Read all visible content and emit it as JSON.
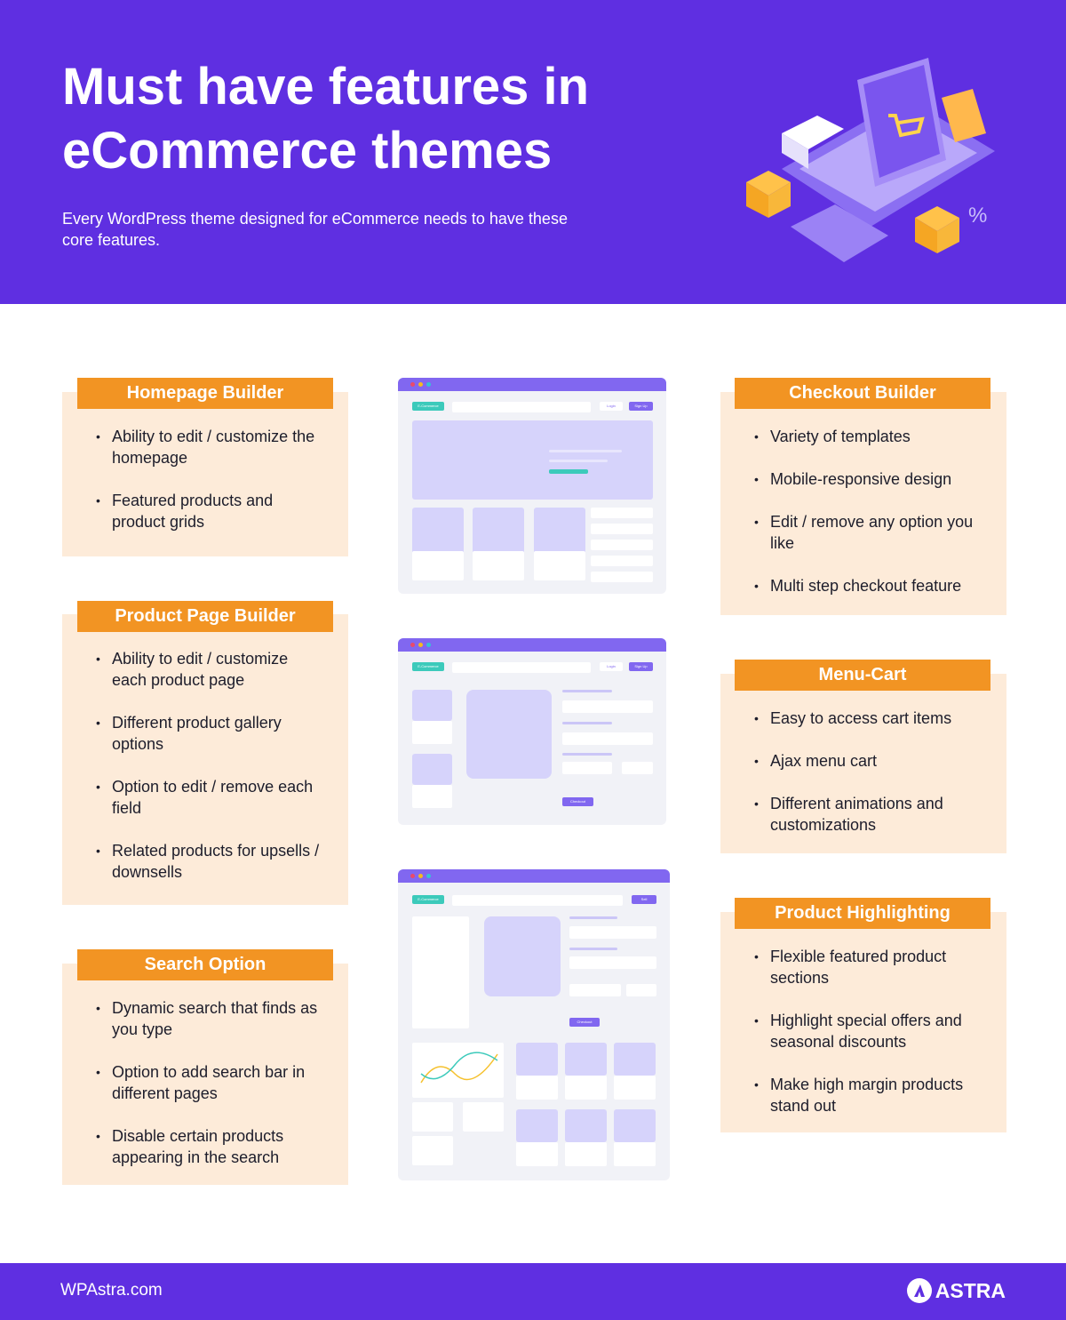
{
  "header": {
    "title": "Must have features in eCommerce themes",
    "subtitle": "Every WordPress theme designed for eCommerce needs to have these core features.",
    "illustration": "laptop-shopping-cart-illustration"
  },
  "colors": {
    "primary": "#5f2fe1",
    "accent": "#f29423",
    "card": "#fdebd9",
    "teal": "#3ccabb"
  },
  "features": [
    {
      "title": "Homepage Builder",
      "items": [
        "Ability to edit / customize the homepage",
        "Featured products and product grids"
      ]
    },
    {
      "title": "Product Page Builder",
      "items": [
        "Ability to edit / customize each product page",
        "Different product gallery options",
        "Option to edit / remove each field",
        "Related products for upsells / downsells"
      ]
    },
    {
      "title": "Search Option",
      "items": [
        "Dynamic search that finds as you type",
        "Option to add search bar in different pages",
        "Disable certain products appearing in the search"
      ]
    },
    {
      "title": "Checkout Builder",
      "items": [
        "Variety of templates",
        "Mobile-responsive design",
        "Edit / remove any option you like",
        "Multi step checkout feature"
      ]
    },
    {
      "title": "Menu-Cart",
      "items": [
        "Easy to access cart items",
        "Ajax menu cart",
        "Different animations and customizations"
      ]
    },
    {
      "title": "Product Highlighting",
      "items": [
        "Flexible featured product sections",
        "Highlight special offers and seasonal discounts",
        "Make high margin products stand out"
      ]
    }
  ],
  "mockups": {
    "brand": "E-Commerce",
    "login": "Login",
    "signup": "Sign Up",
    "checkout": "Checkout",
    "sell": "Sell"
  },
  "footer": {
    "site": "WPAstra.com",
    "logo": "ASTRA"
  }
}
